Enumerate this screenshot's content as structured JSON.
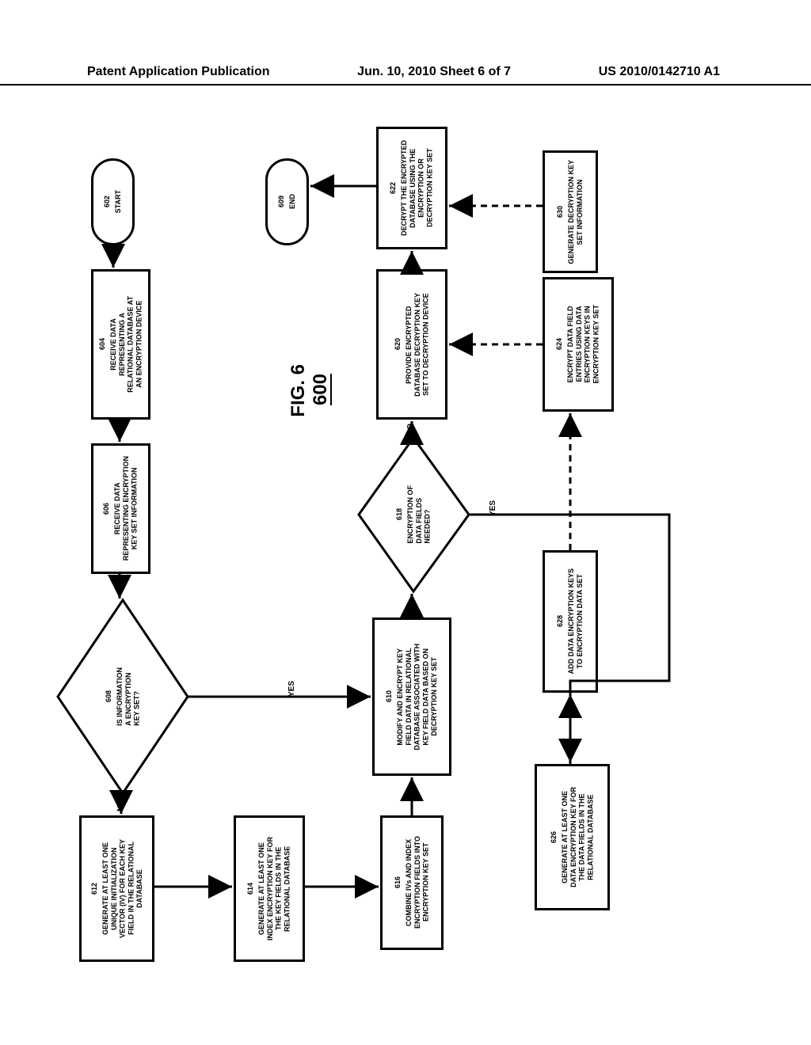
{
  "header": {
    "left": "Patent Application Publication",
    "center": "Jun. 10, 2010  Sheet 6 of 7",
    "right": "US 2010/0142710 A1"
  },
  "figure": {
    "title": "FIG. 6",
    "number": "600"
  },
  "nodes": {
    "start": {
      "label": "START",
      "num": "602"
    },
    "end": {
      "label": "END",
      "num": "609"
    },
    "n604": {
      "label": "RECEIVE DATA\nREPRESENTING A\nRELATIONAL DATABASE AT\nAN ENCRYPTION DEVICE",
      "num": "604"
    },
    "n606": {
      "label": "RECEIVE DATA\nREPRESENTING ENCRYPTION\nKEY SET INFORMATION",
      "num": "606"
    },
    "n608": {
      "label": "IS INFORMATION\nA ENCRYPTION\nKEY SET?",
      "num": "608"
    },
    "n610": {
      "label": "MODIFY AND ENCRYPT KEY\nFIELD DATA IN RELATIONAL\nDATABASE ASSOCIATED WITH\nKEY FIELD DATA BASED ON\nDECRYPTION KEY SET",
      "num": "610"
    },
    "n612": {
      "label": "GENERATE AT LEAST ONE\nUNIQUE INITIALIZATION\nVECTOR (IV) FOR EACH KEY\nFIELD IN THE RELATIONAL\nDATABASE",
      "num": "612"
    },
    "n614": {
      "label": "GENERATE AT LEAST ONE\nINDEX ENCRYPTION KEY FOR\nTHE KEY FIELDS IN THE\nRELATIONAL DATABASE",
      "num": "614"
    },
    "n616": {
      "label": "COMBINE IVs AND INDEX\nENCRYPTION FIELDS INTO\nENCRYPTION KEY SET",
      "num": "616"
    },
    "n618": {
      "label": "ENCRYPTION OF\nDATA FIELDS\nNEEDED?",
      "num": "618"
    },
    "n620": {
      "label": "PROVIDE ENCRYPTED\nDATABASE DECRYPTION KEY\nSET TO DECRYPTION DEVICE",
      "num": "620"
    },
    "n622": {
      "label": "DECRYPT THE ENCRYPTED\nDATABASE USING THE\nENCRYPTION OR\nDECRYPTION KEY SET",
      "num": "622"
    },
    "n624": {
      "label": "ENCRYPT DATA FIELD\nENTRIES USING DATA\nENCRYPTION KEYS IN\nENCRYPTION KEY SET",
      "num": "624"
    },
    "n626": {
      "label": "GENERATE AT LEAST ONE\nDATA ENCRYPTION KEY FOR\nTHE DATA FIELDS IN THE\nRELATIONAL DATABASE",
      "num": "626"
    },
    "n628": {
      "label": "ADD DATA ENCRYPTION KEYS\nTO ENCRYPTION DATA SET",
      "num": "628"
    },
    "n630": {
      "label": "GENERATE DECRYPTION KEY\nSET INFORMATION",
      "num": "630"
    }
  },
  "edges": {
    "yes": "YES",
    "no": "NO"
  }
}
